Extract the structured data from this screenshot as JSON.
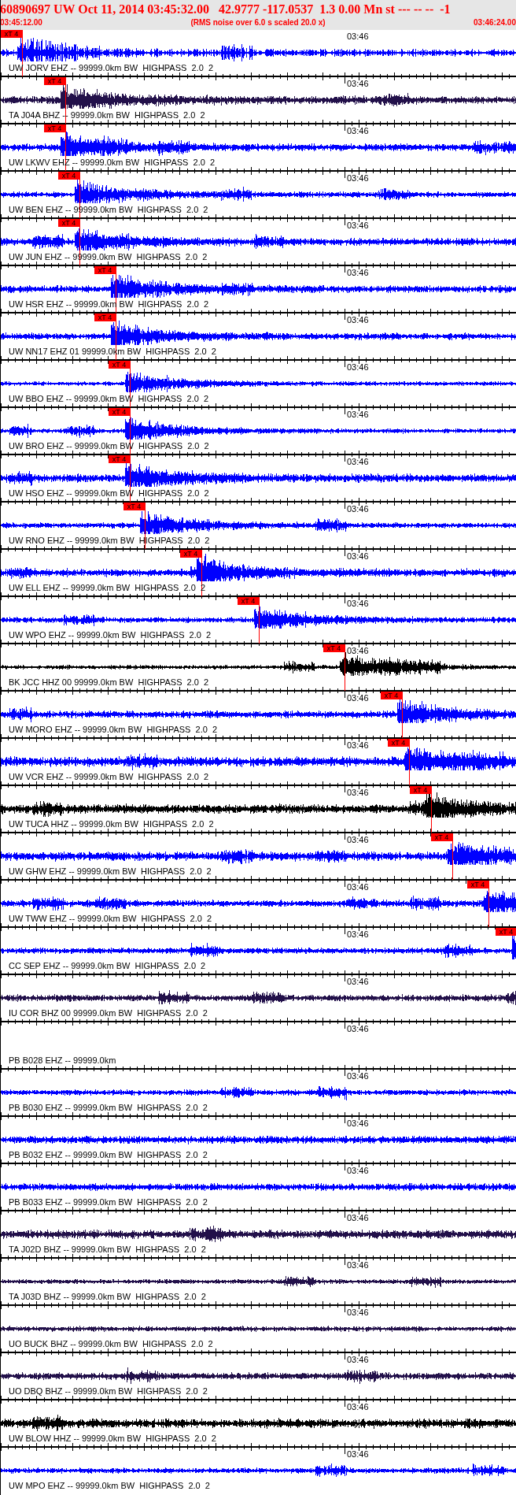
{
  "header": {
    "title": "60890697 UW Oct 11, 2014 03:45:32.00   42.9777 -117.0537  1.3 0.00 Mn st --- -- --  -1",
    "start_time": "03:45:12.00",
    "note": "(RMS noise over 6.0 s scaled 20.0 x)",
    "end_time": "03:46:24.00"
  },
  "traces": [
    {
      "label": "UW JORV EHZ -- 99999.0km BW  HIGHPASS  2.0  2",
      "color": "#0000ff",
      "time_mark": "03:46",
      "pick": {
        "label": "xT 4"
      }
    },
    {
      "label": "TA J04A BHZ -- 99999.0km BW  HIGHPASS  2.0  2",
      "color": "#22104a",
      "time_mark": "03:46",
      "pick": {
        "label": "xT 4"
      }
    },
    {
      "label": "UW LKWV EHZ -- 99999.0km BW  HIGHPASS  2.0  2",
      "color": "#0000ff",
      "time_mark": "03:46",
      "pick": {
        "label": "xT 4"
      }
    },
    {
      "label": "UW BEN EHZ -- 99999.0km BW  HIGHPASS  2.0  2",
      "color": "#0000ff",
      "time_mark": "03:46",
      "pick": {
        "label": "xT 4"
      }
    },
    {
      "label": "UW JUN EHZ -- 99999.0km BW  HIGHPASS  2.0  2",
      "color": "#0000ff",
      "time_mark": "03:46",
      "pick": {
        "label": "xT 4"
      }
    },
    {
      "label": "UW HSR EHZ -- 99999.0km BW  HIGHPASS  2.0  2",
      "color": "#0000ff",
      "time_mark": "03:46",
      "pick": {
        "label": "xT 4"
      }
    },
    {
      "label": "UW NN17 EHZ 01 99999.0km BW  HIGHPASS  2.0  2",
      "color": "#0000ff",
      "time_mark": "03:46",
      "pick": {
        "label": "xT 4"
      }
    },
    {
      "label": "UW BBO EHZ -- 99999.0km BW  HIGHPASS  2.0  2",
      "color": "#0000ff",
      "time_mark": "03:46",
      "pick": {
        "label": "xT 4"
      }
    },
    {
      "label": "UW BRO EHZ -- 99999.0km BW  HIGHPASS  2.0  2",
      "color": "#0000ff",
      "time_mark": "03:46",
      "pick": {
        "label": "xT 4"
      }
    },
    {
      "label": "UW HSO EHZ -- 99999.0km BW  HIGHPASS  2.0  2",
      "color": "#0000ff",
      "time_mark": "03:46",
      "pick": {
        "label": "xT 4"
      }
    },
    {
      "label": "UW RNO EHZ -- 99999.0km BW  HIGHPASS  2.0  2",
      "color": "#0000ff",
      "time_mark": "03:46",
      "pick": {
        "label": "xT 4"
      }
    },
    {
      "label": "UW ELL EHZ -- 99999.0km BW  HIGHPASS  2.0  2",
      "color": "#0000ff",
      "time_mark": "03:46",
      "pick": {
        "label": "xT 4"
      }
    },
    {
      "label": "UW WPO EHZ -- 99999.0km BW  HIGHPASS  2.0  2",
      "color": "#0000ff",
      "time_mark": "03:46",
      "pick": {
        "label": "xT 4"
      }
    },
    {
      "label": "BK JCC HHZ 00 99999.0km BW  HIGHPASS  2.0  2",
      "color": "#000000",
      "time_mark": "03:46",
      "pick": {
        "label": "xT 4"
      }
    },
    {
      "label": "UW MORO EHZ -- 99999.0km BW  HIGHPASS  2.0  2",
      "color": "#0000ff",
      "time_mark": "03:46",
      "pick": {
        "label": "xT 4"
      }
    },
    {
      "label": "UW VCR EHZ -- 99999.0km BW  HIGHPASS  2.0  2",
      "color": "#0000ff",
      "time_mark": "03:46",
      "pick": {
        "label": "xT 4"
      }
    },
    {
      "label": "UW TUCA HHZ -- 99999.0km BW  HIGHPASS  2.0  2",
      "color": "#000000",
      "time_mark": "03:46",
      "pick": {
        "label": "xT 4"
      }
    },
    {
      "label": "UW GHW EHZ -- 99999.0km BW  HIGHPASS  2.0  2",
      "color": "#0000ff",
      "time_mark": "03:46",
      "pick": {
        "label": "xT 4"
      }
    },
    {
      "label": "UW TWW EHZ -- 99999.0km BW  HIGHPASS  2.0  2",
      "color": "#0000ff",
      "time_mark": "03:46",
      "pick": {
        "label": "xT 4"
      }
    },
    {
      "label": "CC SEP EHZ -- 99999.0km BW  HIGHPASS  2.0  2",
      "color": "#0000ff",
      "time_mark": "03:46",
      "pick": {
        "label": "xT 4"
      }
    },
    {
      "label": "IU COR BHZ 00 99999.0km BW  HIGHPASS  2.0  2",
      "color": "#22104a",
      "time_mark": "03:46"
    },
    {
      "label": "PB B028 EHZ -- 99999.0km",
      "time_mark": "03:46"
    },
    {
      "label": "PB B030 EHZ -- 99999.0km BW  HIGHPASS  2.0  2",
      "color": "#0000ff",
      "time_mark": "03:46"
    },
    {
      "label": "PB B032 EHZ -- 99999.0km BW  HIGHPASS  2.0  2",
      "color": "#0000ff",
      "time_mark": "03:46"
    },
    {
      "label": "PB B033 EHZ -- 99999.0km BW  HIGHPASS  2.0  2",
      "color": "#0000ff",
      "time_mark": "03:46"
    },
    {
      "label": "TA J02D BHZ -- 99999.0km BW  HIGHPASS  2.0  2",
      "color": "#22104a",
      "time_mark": "03:46"
    },
    {
      "label": "TA J03D BHZ -- 99999.0km BW  HIGHPASS  2.0  2",
      "color": "#22104a",
      "time_mark": "03:46"
    },
    {
      "label": "UO BUCK BHZ -- 99999.0km BW  HIGHPASS  2.0  2",
      "color": "#22104a",
      "time_mark": "03:46"
    },
    {
      "label": "UO DBQ BHZ -- 99999.0km BW  HIGHPASS  2.0  2",
      "color": "#22104a",
      "time_mark": "03:46"
    },
    {
      "label": "UW BLOW HHZ -- 99999.0km BW  HIGHPASS  2.0  2",
      "color": "#000000",
      "time_mark": "03:46"
    },
    {
      "label": "UW MPO EHZ -- 99999.0km BW  HIGHPASS  2.0  2",
      "color": "#0000ff",
      "time_mark": "03:46"
    }
  ]
}
